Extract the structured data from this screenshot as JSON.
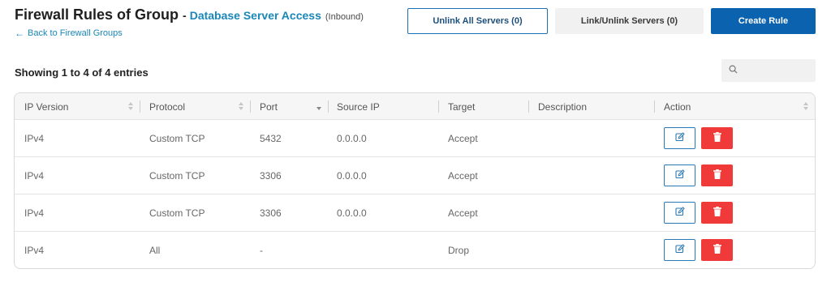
{
  "header": {
    "title": "Firewall Rules of Group",
    "separator": "-",
    "group_name": "Database Server Access",
    "direction": "(Inbound)",
    "back_link": "Back to Firewall Groups"
  },
  "toolbar": {
    "unlink_all": "Unlink All Servers (0)",
    "link_unlink": "Link/Unlink Servers (0)",
    "create_rule": "Create Rule"
  },
  "table_info": {
    "showing": "Showing 1 to 4 of 4 entries"
  },
  "search": {
    "placeholder": "",
    "value": ""
  },
  "table": {
    "columns": [
      "IP Version",
      "Protocol",
      "Port",
      "Source IP",
      "Target",
      "Description",
      "Action"
    ],
    "rows": [
      {
        "ip_version": "IPv4",
        "protocol": "Custom TCP",
        "port": "5432",
        "source_ip": "0.0.0.0",
        "target": "Accept",
        "description": ""
      },
      {
        "ip_version": "IPv4",
        "protocol": "Custom TCP",
        "port": "3306",
        "source_ip": "0.0.0.0",
        "target": "Accept",
        "description": ""
      },
      {
        "ip_version": "IPv4",
        "protocol": "Custom TCP",
        "port": "3306",
        "source_ip": "0.0.0.0",
        "target": "Accept",
        "description": ""
      },
      {
        "ip_version": "IPv4",
        "protocol": "All",
        "port": "-",
        "source_ip": "",
        "target": "Drop",
        "description": ""
      }
    ]
  },
  "icons": {
    "edit": "edit-icon",
    "delete": "trash-icon",
    "search": "search-icon",
    "back": "arrow-left-icon"
  },
  "colors": {
    "accent_blue": "#1a87b8",
    "primary_button": "#0b63b0",
    "danger": "#f03a3a"
  }
}
